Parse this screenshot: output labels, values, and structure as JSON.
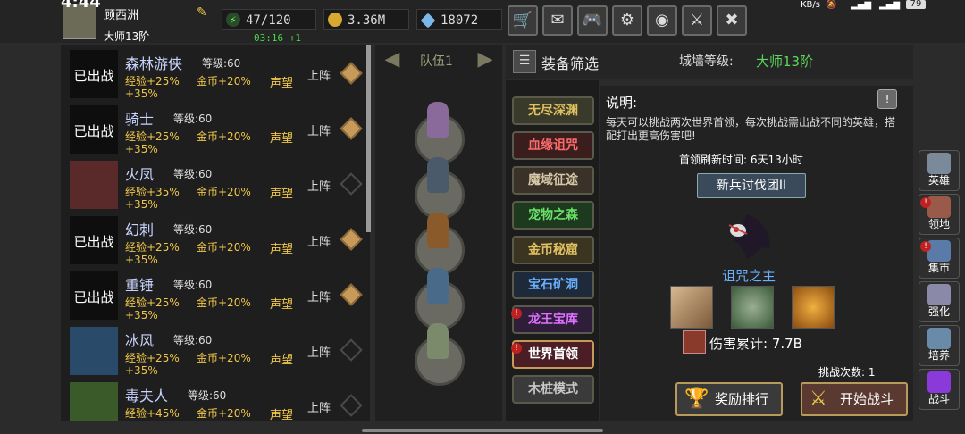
{
  "status_bar": {
    "time": "4:44",
    "net": "KB/s",
    "battery": "79"
  },
  "player": {
    "name": "顾西洲",
    "rank": "大师13阶"
  },
  "resources": {
    "energy": "47/120",
    "gold": "3.36M",
    "gems": "18072",
    "timer": "03:16 +1"
  },
  "top_buttons": [
    {
      "name": "shop-cart-icon",
      "glyph": "🛒"
    },
    {
      "name": "mail-icon",
      "glyph": "✉"
    },
    {
      "name": "gamepad-icon",
      "glyph": "🎮"
    },
    {
      "name": "settings-gear-icon",
      "glyph": "⚙"
    },
    {
      "name": "color-wheel-icon",
      "glyph": "◉"
    },
    {
      "name": "swords-icon",
      "glyph": "⚔"
    },
    {
      "name": "crossed-swords-icon",
      "glyph": "✖"
    }
  ],
  "heroes": [
    {
      "name": "森林游侠",
      "level": "等级:60",
      "exp": "经验+25%",
      "gold": "金币+20%",
      "fame": "声望",
      "extra": "+35%",
      "deployed": "已出战",
      "action": "上阵",
      "active": true
    },
    {
      "name": "骑士",
      "level": "等级:60",
      "exp": "经验+25%",
      "gold": "金币+20%",
      "fame": "声望",
      "extra": "+35%",
      "deployed": "已出战",
      "action": "上阵",
      "active": true
    },
    {
      "name": "火凤",
      "level": "等级:60",
      "exp": "经验+35%",
      "gold": "金币+20%",
      "fame": "声望",
      "extra": "+35%",
      "deployed": "",
      "action": "上阵",
      "active": false
    },
    {
      "name": "幻刺",
      "level": "等级:60",
      "exp": "经验+25%",
      "gold": "金币+20%",
      "fame": "声望",
      "extra": "+35%",
      "deployed": "已出战",
      "action": "上阵",
      "active": true
    },
    {
      "name": "重锤",
      "level": "等级:60",
      "exp": "经验+25%",
      "gold": "金币+20%",
      "fame": "声望",
      "extra": "+35%",
      "deployed": "已出战",
      "action": "上阵",
      "active": true
    },
    {
      "name": "冰风",
      "level": "等级:60",
      "exp": "经验+25%",
      "gold": "金币+20%",
      "fame": "声望",
      "extra": "+35%",
      "deployed": "",
      "action": "上阵",
      "active": false
    },
    {
      "name": "毒夫人",
      "level": "等级:60",
      "exp": "经验+45%",
      "gold": "金币+20%",
      "fame": "声望",
      "extra": "",
      "deployed": "",
      "action": "上阵",
      "active": false
    }
  ],
  "team": {
    "label": "队伍1"
  },
  "filter": {
    "label": "装备筛选",
    "wall_label": "城墙等级:",
    "wall_value": "大师13阶"
  },
  "modes": [
    {
      "label": "无尽深渊",
      "color": "#e0c060",
      "bg": "#3a3a2a",
      "alert": false
    },
    {
      "label": "血缘诅咒",
      "color": "#ff6a6a",
      "bg": "#3a1e1e",
      "alert": false
    },
    {
      "label": "魔域征途",
      "color": "#d8c8a8",
      "bg": "#3a3228",
      "alert": false
    },
    {
      "label": "宠物之森",
      "color": "#6ae06a",
      "bg": "#1e3a1e",
      "alert": false
    },
    {
      "label": "金币秘窟",
      "color": "#e0c060",
      "bg": "#3a3420",
      "alert": false
    },
    {
      "label": "宝石矿洞",
      "color": "#6ab0ff",
      "bg": "#1e2a3a",
      "alert": false
    },
    {
      "label": "龙王宝库",
      "color": "#e070ff",
      "bg": "#2e1e3a",
      "alert": true
    },
    {
      "label": "世界首领",
      "color": "#ffffff",
      "bg": "#4a1e24",
      "alert": true
    },
    {
      "label": "木桩模式",
      "color": "#c8c8c8",
      "bg": "#3a3a3a",
      "alert": false
    }
  ],
  "detail": {
    "desc_label": "说明:",
    "desc_text": "每天可以挑战两次世界首领，每次挑战需出战不同的英雄，搭配打出更高伤害吧!",
    "refresh": "首领刷新时间: 6天13小时",
    "boss_group": "新兵讨伐团II",
    "boss_name": "诅咒之主",
    "damage": "伤害累计: 7.7B",
    "attempts": "挑战次数: 1",
    "rank_button": "奖励排行",
    "fight_button": "开始战斗"
  },
  "right_nav": [
    {
      "label": "英雄",
      "icon": "helmet-icon",
      "color": "#7a8a9a",
      "alert": false
    },
    {
      "label": "领地",
      "icon": "castle-icon",
      "color": "#9a5a4a",
      "alert": true
    },
    {
      "label": "集市",
      "icon": "market-icon",
      "color": "#5a7aa8",
      "alert": true
    },
    {
      "label": "强化",
      "icon": "enhance-icon",
      "color": "#8a8aa8",
      "alert": false
    },
    {
      "label": "培养",
      "icon": "cultivate-icon",
      "color": "#6a8aaa",
      "alert": false
    },
    {
      "label": "战斗",
      "icon": "portal-icon",
      "color": "#8a3ad8",
      "alert": false
    }
  ]
}
